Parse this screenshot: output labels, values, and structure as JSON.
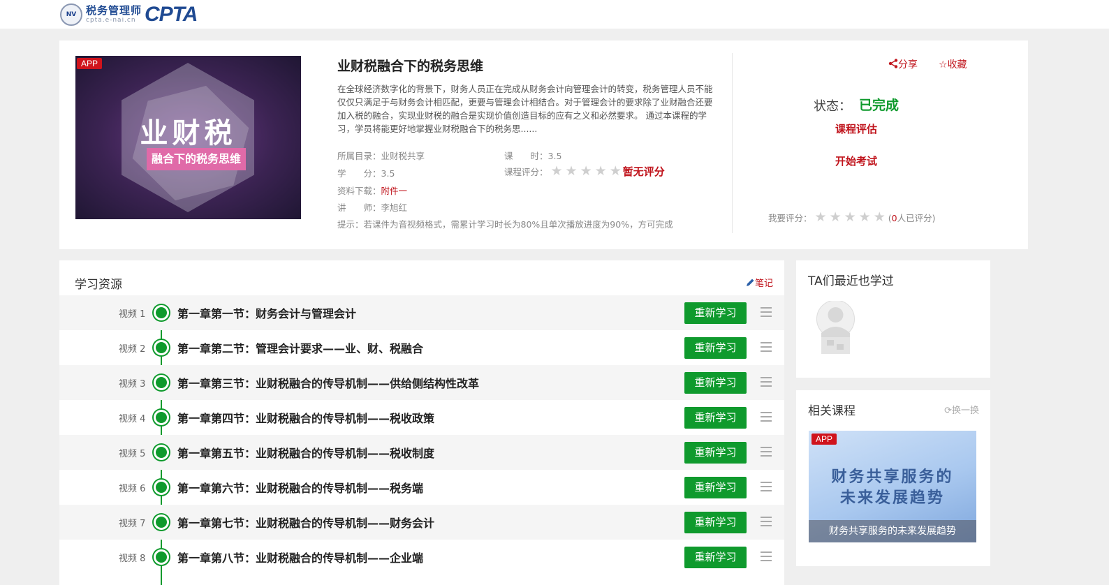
{
  "header": {
    "logo_emblem": "NV",
    "logo_cn": "税务管理师",
    "logo_url": "cpta.e-nai.cn",
    "logo_brand": "CPTA"
  },
  "course": {
    "cover_badge": "APP",
    "cover_title": "业财税",
    "cover_subtitle": "融合下的税务思维",
    "title": "业财税融合下的税务思维",
    "description": "在全球经济数字化的背景下，财务人员正在完成从财务会计向管理会计的转变，税务管理人员不能仅仅只满足于与财务会计相匹配，更要与管理会计相结合。对于管理会计的要求除了业财融合还要加入税的融合，实现业财税的融合是实现价值创造目标的应有之义和必然要求。 通过本课程的学习，学员将能更好地掌握业财税融合下的税务思......",
    "catalog_label": "所属目录：",
    "catalog_value": "业财税共享",
    "hours_label": "课　　时：",
    "hours_value": "3.5",
    "credits_label": "学　　分：",
    "credits_value": "3.5",
    "rating_label": "课程评分：",
    "rating_value": 0,
    "no_rating": "暂无评分",
    "download_label": "资料下载：",
    "download_value": "附件一",
    "teacher_label": "讲　　师：",
    "teacher_value": "李旭红",
    "tip": "提示：若课件为音视频格式，需累计学习时长为80%且单次播放进度为90%，方可完成"
  },
  "actions": {
    "share": "分享",
    "favorite": "收藏",
    "status_label": "状态：",
    "status_value": "已完成",
    "evaluate": "课程评估",
    "exam": "开始考试",
    "my_rating_label": "我要评分：",
    "my_rating_count_prefix": "(",
    "my_rating_count": "0",
    "my_rating_count_suffix": "人已评分)"
  },
  "resources": {
    "title": "学习资源",
    "notes": "笔记",
    "button_label": "重新学习",
    "items": [
      {
        "label": "视频 1",
        "name": "第一章第一节：财务会计与管理会计"
      },
      {
        "label": "视频 2",
        "name": "第一章第二节：管理会计要求——业、财、税融合"
      },
      {
        "label": "视频 3",
        "name": "第一章第三节：业财税融合的传导机制——供给侧结构性改革"
      },
      {
        "label": "视频 4",
        "name": "第一章第四节：业财税融合的传导机制——税收政策"
      },
      {
        "label": "视频 5",
        "name": "第一章第五节：业财税融合的传导机制——税收制度"
      },
      {
        "label": "视频 6",
        "name": "第一章第六节：业财税融合的传导机制——税务端"
      },
      {
        "label": "视频 7",
        "name": "第一章第七节：业财税融合的传导机制——财务会计"
      },
      {
        "label": "视频 8",
        "name": "第一章第八节：业财税融合的传导机制——企业端"
      }
    ]
  },
  "sidebar": {
    "recent_title": "TA们最近也学过",
    "related_title": "相关课程",
    "refresh": "换一换",
    "related_badge": "APP",
    "related_cover_line1": "财务共享服务的",
    "related_cover_line2": "未来发展趋势",
    "related_caption": "财务共享服务的未来发展趋势"
  },
  "colors": {
    "accent_red": "#c0141c",
    "accent_green": "#0f9a2d",
    "brand_blue": "#1f4a92"
  }
}
